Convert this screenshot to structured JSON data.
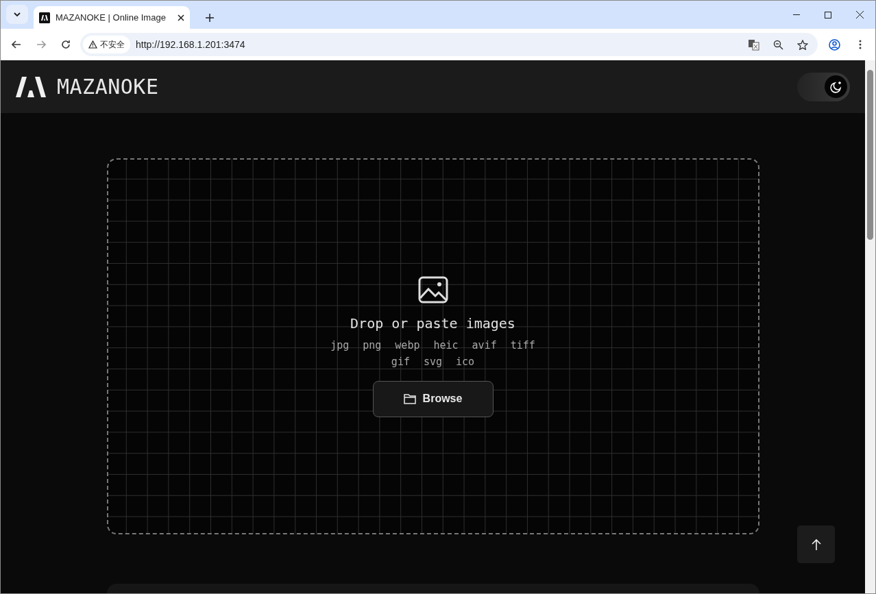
{
  "browser": {
    "tab_title": "MAZANOKE | Online Image",
    "security_label": "不安全",
    "url": "http://192.168.1.201:3474"
  },
  "header": {
    "logo_text": "MAZANOKE",
    "dark_mode": true
  },
  "dropzone": {
    "title": "Drop or paste images",
    "formats": [
      "jpg",
      "png",
      "webp",
      "heic",
      "avif",
      "tiff",
      "gif",
      "svg",
      "ico"
    ],
    "browse_label": "Browse"
  }
}
